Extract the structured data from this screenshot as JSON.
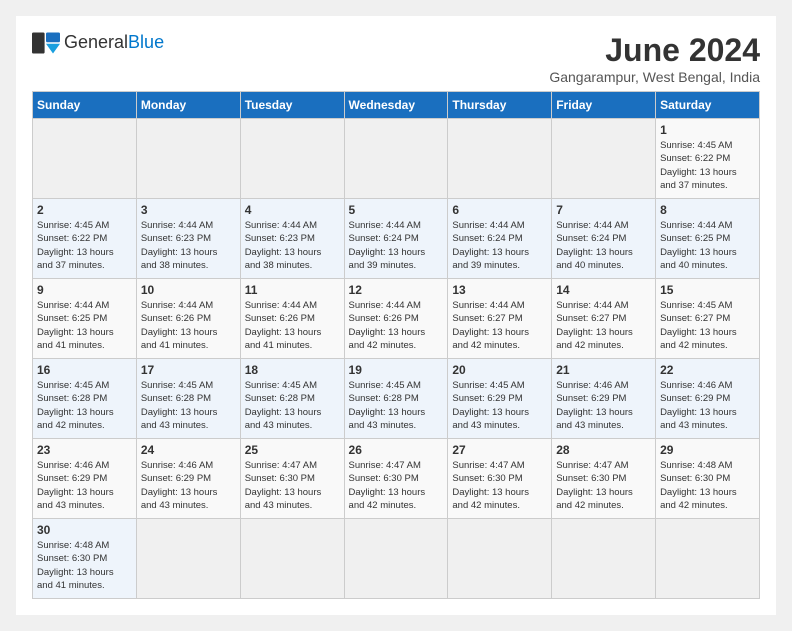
{
  "logo": {
    "text_general": "General",
    "text_blue": "Blue"
  },
  "header": {
    "title": "June 2024",
    "subtitle": "Gangarampur, West Bengal, India"
  },
  "days_of_week": [
    "Sunday",
    "Monday",
    "Tuesday",
    "Wednesday",
    "Thursday",
    "Friday",
    "Saturday"
  ],
  "weeks": [
    [
      {
        "day": "",
        "info": ""
      },
      {
        "day": "",
        "info": ""
      },
      {
        "day": "",
        "info": ""
      },
      {
        "day": "",
        "info": ""
      },
      {
        "day": "",
        "info": ""
      },
      {
        "day": "",
        "info": ""
      },
      {
        "day": "1",
        "info": "Sunrise: 4:45 AM\nSunset: 6:22 PM\nDaylight: 13 hours and 37 minutes."
      }
    ],
    [
      {
        "day": "2",
        "info": "Sunrise: 4:45 AM\nSunset: 6:22 PM\nDaylight: 13 hours and 37 minutes."
      },
      {
        "day": "3",
        "info": "Sunrise: 4:44 AM\nSunset: 6:23 PM\nDaylight: 13 hours and 38 minutes."
      },
      {
        "day": "4",
        "info": "Sunrise: 4:44 AM\nSunset: 6:23 PM\nDaylight: 13 hours and 38 minutes."
      },
      {
        "day": "5",
        "info": "Sunrise: 4:44 AM\nSunset: 6:24 PM\nDaylight: 13 hours and 39 minutes."
      },
      {
        "day": "6",
        "info": "Sunrise: 4:44 AM\nSunset: 6:24 PM\nDaylight: 13 hours and 39 minutes."
      },
      {
        "day": "7",
        "info": "Sunrise: 4:44 AM\nSunset: 6:24 PM\nDaylight: 13 hours and 40 minutes."
      },
      {
        "day": "8",
        "info": "Sunrise: 4:44 AM\nSunset: 6:25 PM\nDaylight: 13 hours and 40 minutes."
      }
    ],
    [
      {
        "day": "9",
        "info": "Sunrise: 4:44 AM\nSunset: 6:25 PM\nDaylight: 13 hours and 41 minutes."
      },
      {
        "day": "10",
        "info": "Sunrise: 4:44 AM\nSunset: 6:26 PM\nDaylight: 13 hours and 41 minutes."
      },
      {
        "day": "11",
        "info": "Sunrise: 4:44 AM\nSunset: 6:26 PM\nDaylight: 13 hours and 41 minutes."
      },
      {
        "day": "12",
        "info": "Sunrise: 4:44 AM\nSunset: 6:26 PM\nDaylight: 13 hours and 42 minutes."
      },
      {
        "day": "13",
        "info": "Sunrise: 4:44 AM\nSunset: 6:27 PM\nDaylight: 13 hours and 42 minutes."
      },
      {
        "day": "14",
        "info": "Sunrise: 4:44 AM\nSunset: 6:27 PM\nDaylight: 13 hours and 42 minutes."
      },
      {
        "day": "15",
        "info": "Sunrise: 4:45 AM\nSunset: 6:27 PM\nDaylight: 13 hours and 42 minutes."
      }
    ],
    [
      {
        "day": "16",
        "info": "Sunrise: 4:45 AM\nSunset: 6:28 PM\nDaylight: 13 hours and 42 minutes."
      },
      {
        "day": "17",
        "info": "Sunrise: 4:45 AM\nSunset: 6:28 PM\nDaylight: 13 hours and 43 minutes."
      },
      {
        "day": "18",
        "info": "Sunrise: 4:45 AM\nSunset: 6:28 PM\nDaylight: 13 hours and 43 minutes."
      },
      {
        "day": "19",
        "info": "Sunrise: 4:45 AM\nSunset: 6:28 PM\nDaylight: 13 hours and 43 minutes."
      },
      {
        "day": "20",
        "info": "Sunrise: 4:45 AM\nSunset: 6:29 PM\nDaylight: 13 hours and 43 minutes."
      },
      {
        "day": "21",
        "info": "Sunrise: 4:46 AM\nSunset: 6:29 PM\nDaylight: 13 hours and 43 minutes."
      },
      {
        "day": "22",
        "info": "Sunrise: 4:46 AM\nSunset: 6:29 PM\nDaylight: 13 hours and 43 minutes."
      }
    ],
    [
      {
        "day": "23",
        "info": "Sunrise: 4:46 AM\nSunset: 6:29 PM\nDaylight: 13 hours and 43 minutes."
      },
      {
        "day": "24",
        "info": "Sunrise: 4:46 AM\nSunset: 6:29 PM\nDaylight: 13 hours and 43 minutes."
      },
      {
        "day": "25",
        "info": "Sunrise: 4:47 AM\nSunset: 6:30 PM\nDaylight: 13 hours and 43 minutes."
      },
      {
        "day": "26",
        "info": "Sunrise: 4:47 AM\nSunset: 6:30 PM\nDaylight: 13 hours and 42 minutes."
      },
      {
        "day": "27",
        "info": "Sunrise: 4:47 AM\nSunset: 6:30 PM\nDaylight: 13 hours and 42 minutes."
      },
      {
        "day": "28",
        "info": "Sunrise: 4:47 AM\nSunset: 6:30 PM\nDaylight: 13 hours and 42 minutes."
      },
      {
        "day": "29",
        "info": "Sunrise: 4:48 AM\nSunset: 6:30 PM\nDaylight: 13 hours and 42 minutes."
      }
    ],
    [
      {
        "day": "30",
        "info": "Sunrise: 4:48 AM\nSunset: 6:30 PM\nDaylight: 13 hours and 41 minutes."
      },
      {
        "day": "",
        "info": ""
      },
      {
        "day": "",
        "info": ""
      },
      {
        "day": "",
        "info": ""
      },
      {
        "day": "",
        "info": ""
      },
      {
        "day": "",
        "info": ""
      },
      {
        "day": "",
        "info": ""
      }
    ]
  ]
}
